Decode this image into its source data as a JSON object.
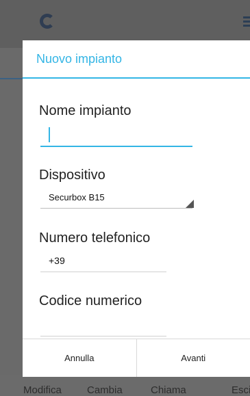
{
  "background": {
    "bottom_tabs": [
      "Modifica",
      "Cambia",
      "Chiama",
      "Esci"
    ]
  },
  "dialog": {
    "title": "Nuovo impianto",
    "fields": {
      "nome": {
        "label": "Nome impianto",
        "value": "",
        "placeholder": ""
      },
      "dispositivo": {
        "label": "Dispositivo",
        "selected": "Securbox B15"
      },
      "telefono": {
        "label": "Numero telefonico",
        "value": "+39"
      },
      "codice": {
        "label": "Codice numerico",
        "value": ""
      }
    },
    "buttons": {
      "cancel": "Annulla",
      "next": "Avanti"
    }
  },
  "colors": {
    "accent": "#33b5e5",
    "dim_background": "#6a6a6a"
  }
}
